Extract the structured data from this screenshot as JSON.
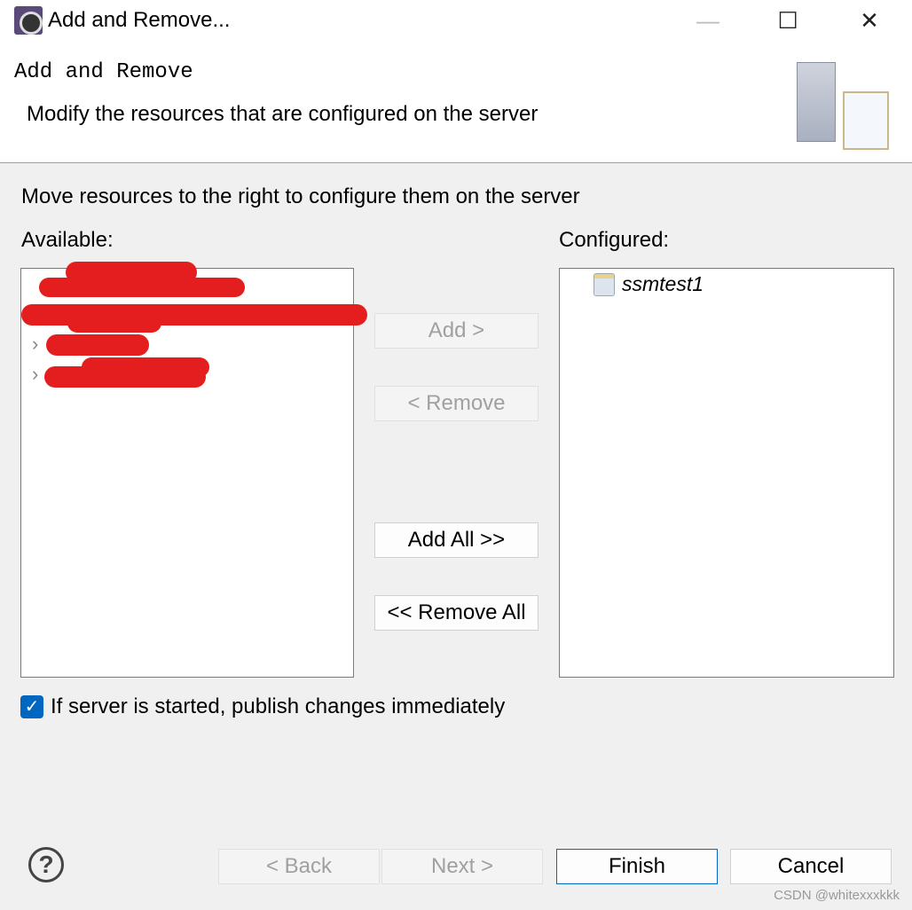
{
  "window": {
    "title": "Add and Remove...",
    "minimize": "—",
    "maximize": "☐",
    "close": "✕"
  },
  "header": {
    "title": "Add and Remove",
    "subtitle": "Modify the resources that are configured on the server"
  },
  "instruction": "Move resources to the right to configure them on the server",
  "available": {
    "label": "Available:"
  },
  "configured": {
    "label": "Configured:",
    "items": [
      {
        "name": "ssmtest1",
        "icon": "web-module-icon"
      }
    ]
  },
  "buttons": {
    "add": "Add >",
    "remove": "< Remove",
    "add_all": "Add All >>",
    "remove_all": "<< Remove All",
    "back": "< Back",
    "next": "Next >",
    "finish": "Finish",
    "cancel": "Cancel",
    "help": "?"
  },
  "publish_checkbox": {
    "label": "If server is started, publish changes immediately",
    "checked": true
  },
  "watermark": "CSDN @whitexxxkkk",
  "colors": {
    "accent": "#0067c0",
    "redaction": "#e41e1e"
  }
}
